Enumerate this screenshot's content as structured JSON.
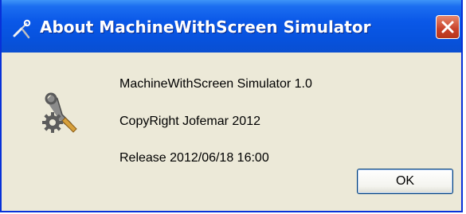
{
  "window": {
    "title": "About MachineWithScreen Simulator",
    "title_icon": "tools-icon",
    "close_icon": "close-icon"
  },
  "content": {
    "app_icon": "wrench-gear-icon",
    "product_line": "MachineWithScreen Simulator 1.0",
    "copyright_line": "CopyRight Jofemar 2012",
    "release_line": "Release 2012/06/18 16:00"
  },
  "buttons": {
    "ok_label": "OK"
  },
  "colors": {
    "titlebar": "#0752dd",
    "close_button": "#c8412a",
    "dialog_background": "#ece9d8",
    "border": "#0831d9"
  }
}
